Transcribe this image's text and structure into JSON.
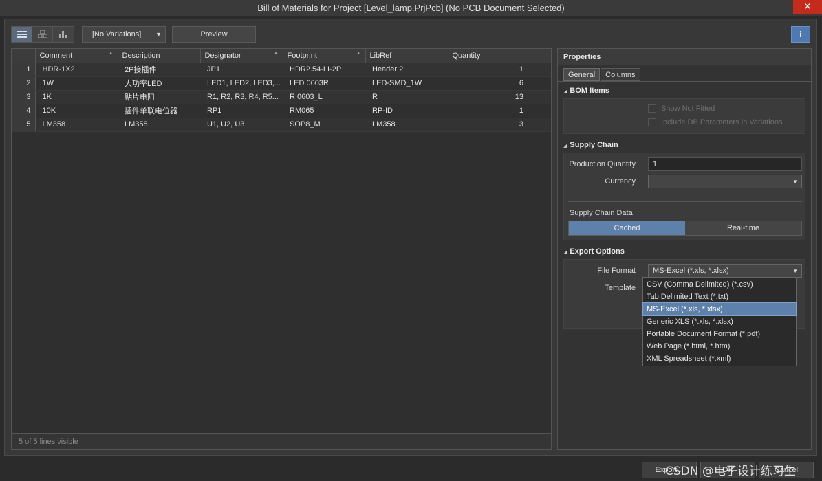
{
  "window": {
    "title": "Bill of Materials for Project [Level_lamp.PrjPcb] (No PCB Document Selected)",
    "close_glyph": "✕"
  },
  "toolbar": {
    "variations_value": "[No Variations]",
    "preview_label": "Preview",
    "info_glyph": "i"
  },
  "grid": {
    "columns": [
      "Comment",
      "Description",
      "Designator",
      "Footprint",
      "LibRef",
      "Quantity"
    ],
    "rows": [
      {
        "idx": "1",
        "comment": "HDR-1X2",
        "description": "2P接插件",
        "designator": "JP1",
        "footprint": "HDR2.54-LI-2P",
        "libref": "Header 2",
        "quantity": "1"
      },
      {
        "idx": "2",
        "comment": "1W",
        "description": "大功率LED",
        "designator": "LED1, LED2, LED3,...",
        "footprint": "LED 0603R",
        "libref": "LED-SMD_1W",
        "quantity": "6"
      },
      {
        "idx": "3",
        "comment": "1K",
        "description": "贴片电阻",
        "designator": "R1, R2, R3, R4, R5...",
        "footprint": "R 0603_L",
        "libref": "R",
        "quantity": "13"
      },
      {
        "idx": "4",
        "comment": "10K",
        "description": "插件单联电位器",
        "designator": "RP1",
        "footprint": "RM065",
        "libref": "RP-ID",
        "quantity": "1"
      },
      {
        "idx": "5",
        "comment": "LM358",
        "description": "LM358",
        "designator": "U1, U2, U3",
        "footprint": "SOP8_M",
        "libref": "LM358",
        "quantity": "3"
      }
    ],
    "footer": "5 of 5 lines visible"
  },
  "properties": {
    "title": "Properties",
    "tabs": [
      "General",
      "Columns"
    ],
    "bom_items": {
      "title": "BOM Items",
      "show_not_fitted": "Show Not Fitted",
      "include_db": "Include DB Parameters in Variations"
    },
    "supply_chain": {
      "title": "Supply Chain",
      "production_qty_label": "Production Quantity",
      "production_qty_value": "1",
      "currency_label": "Currency",
      "currency_value": "",
      "data_label": "Supply Chain Data",
      "cached_label": "Cached",
      "realtime_label": "Real-time"
    },
    "export_options": {
      "title": "Export Options",
      "file_format_label": "File Format",
      "file_format_value": "MS-Excel (*.xls, *.xlsx)",
      "template_label": "Template",
      "format_options": [
        "CSV (Comma Delimited) (*.csv)",
        "Tab Delimited Text (*.txt)",
        "MS-Excel (*.xls, *.xlsx)",
        "Generic XLS (*.xls, *.xlsx)",
        "Portable Document Format (*.pdf)",
        "Web Page (*.html, *.htm)",
        "XML Spreadsheet (*.xml)"
      ]
    }
  },
  "footer_buttons": {
    "export_label": "Export...",
    "ok_label": "OK",
    "cancel_label": "Cancel"
  },
  "watermark": "CSDN @电子设计练习生"
}
